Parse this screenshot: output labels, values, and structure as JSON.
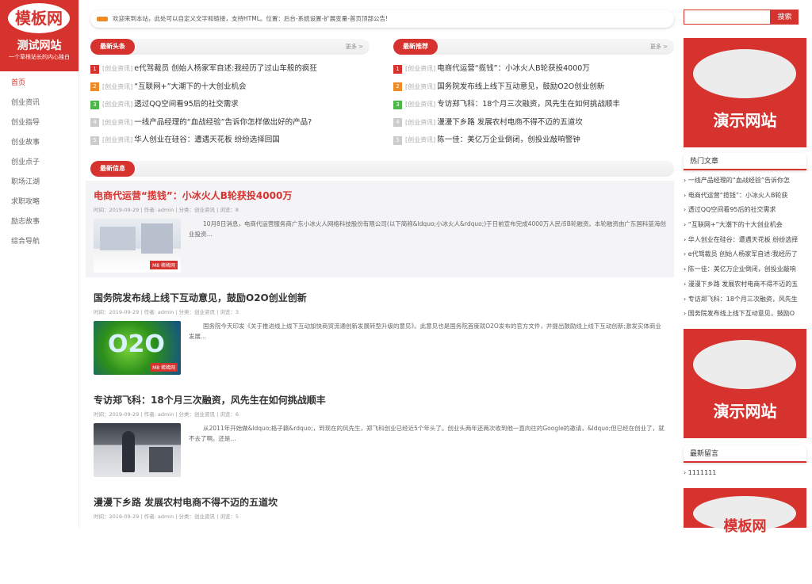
{
  "site": {
    "logo_text": "模板网",
    "name": "测试网站",
    "slogan": "一个草根站长的内心独白"
  },
  "nav": [
    "首页",
    "创业资讯",
    "创业指导",
    "创业故事",
    "创业点子",
    "职场江湖",
    "求职攻略",
    "励志故事",
    "综合导航"
  ],
  "notice": "欢迎来到本站，此处可以自定义文字和链接，支持HTML。位置：后台-系统设置-扩展变量-首页顶部公告!",
  "headlines": {
    "tag": "最新头条",
    "more": "更多 >",
    "items": [
      {
        "num": "1",
        "cat": "[创业资讯]",
        "title": "e代驾裁员 创始人杨家军自述:我经历了过山车般的疯狂"
      },
      {
        "num": "2",
        "cat": "[创业资讯]",
        "title": "“互联网+”大潮下的十大创业机会"
      },
      {
        "num": "3",
        "cat": "[创业资讯]",
        "title": "透过QQ空间看95后的社交需求"
      },
      {
        "num": "4",
        "cat": "[创业资讯]",
        "title": "一线产品经理的“血战经验”告诉你怎样做出好的产品?"
      },
      {
        "num": "5",
        "cat": "[创业资讯]",
        "title": "华人创业在硅谷：遭遇天花板 纷纷选择回国"
      }
    ]
  },
  "recommend": {
    "tag": "最新推荐",
    "more": "更多 >",
    "items": [
      {
        "num": "1",
        "cat": "[创业资讯]",
        "title": "电商代运营“揽钱”：小冰火人B轮获投4000万"
      },
      {
        "num": "2",
        "cat": "[创业资讯]",
        "title": "国务院发布线上线下互动意见，鼓励O2O创业创新"
      },
      {
        "num": "3",
        "cat": "[创业资讯]",
        "title": "专访郑飞科：18个月三次融资，风先生在如何挑战顺丰"
      },
      {
        "num": "4",
        "cat": "[创业资讯]",
        "title": "漫漫下乡路 发展农村电商不得不迈的五道坎"
      },
      {
        "num": "5",
        "cat": "[创业资讯]",
        "title": "陈一佳：美亿万企业倒闭，创投业敲响警钟"
      }
    ]
  },
  "latest": {
    "tag": "最新信息",
    "posts": [
      {
        "title": "电商代运营“揽钱”：小冰火人B轮获投4000万",
        "meta": "时间：2019-09-29 | 作者: admin | 分类：创业资讯 | 浏览：8",
        "excerpt": "10月8日消息，电商代运营服务商广东小冰火人网络科技股份有限公司(以下简称&ldquo;小冰火人&rdquo;)于日前宣布完成4000万人民币B轮融资。本轮融资由广东国科蓝海创业投资..."
      },
      {
        "title": "国务院发布线上线下互动意见，鼓励O2O创业创新",
        "meta": "时间：2019-09-29 | 作者: admin | 分类：创业资讯 | 浏览：3",
        "excerpt": "国务院今天印发《关于推进线上线下互动加快商贸流通创新发展转型升级的意见》。此意见也是国务院首度就O2O发布的官方文件，并提出鼓励线上线下互动创新;激发实体商业发展..."
      },
      {
        "title": "专访郑飞科：18个月三次融资，风先生在如何挑战顺丰",
        "meta": "时间：2019-09-29 | 作者: admin | 分类：创业资讯 | 浏览：6",
        "excerpt": "从2011年开始做&ldquo;格子籍&rdquo;，到现在的风先生，郑飞科创业已经近5个年头了。创业头两年还两次收到他一直向往的Google的邀请，&ldquo;但已经在创业了，就不去了啊。还是..."
      },
      {
        "title": "漫漫下乡路 发展农村电商不得不迈的五道坎",
        "meta": "时间：2019-09-29 | 作者: admin | 分类：创业资讯 | 浏览：5",
        "excerpt": ""
      }
    ]
  },
  "thumb_labels": {
    "p1": "M8 稀稀网",
    "p2": "M8 稀稀网"
  },
  "search": {
    "button": "搜索",
    "placeholder": ""
  },
  "ads": {
    "text": "演示网站",
    "bottom_text": "模板网"
  },
  "hot": {
    "title": "热门文章",
    "items": [
      "一线产品经理的“血战经验”告诉你怎",
      "电商代运营“揽钱”：小冰火人B轮获",
      "透过QQ空间看95后的社交需求",
      "“互联网+”大潮下的十大创业机会",
      "华人创业在硅谷：遭遇天花板 纷纷选择",
      "e代驾裁员 创始人杨家军自述:我经历了",
      "陈一佳：美亿万企业倒闭，创投业敲响",
      "漫漫下乡路 发展农村电商不得不迈的五",
      "专访郑飞科：18个月三次融资，风先生",
      "国务院发布线上线下互动意见，鼓励O"
    ]
  },
  "comments": {
    "title": "最新留言",
    "items": [
      "1111111"
    ]
  },
  "colors": {
    "accent": "#d6332f",
    "num1": "#d6332f",
    "num2": "#f08a24",
    "num3": "#4cb849",
    "num_other": "#cccccc"
  }
}
